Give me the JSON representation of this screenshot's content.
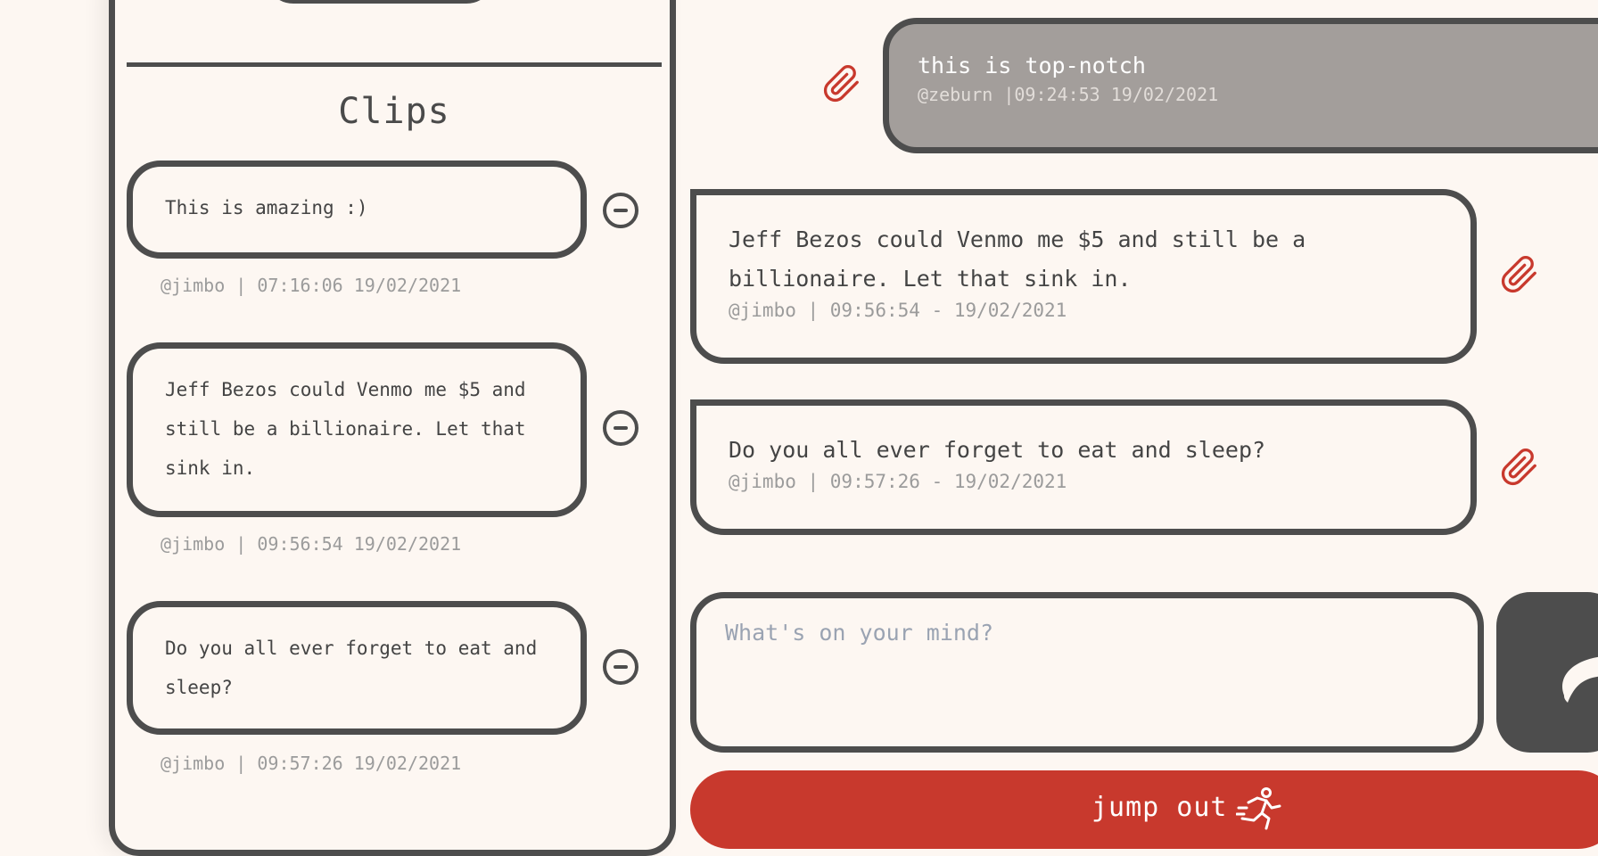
{
  "clips_panel": {
    "title": "Clips",
    "clips": [
      {
        "text": "This is amazing :)",
        "meta": "@jimbo | 07:16:06 19/02/2021"
      },
      {
        "text": "Jeff Bezos could Venmo me $5 and still be a billionaire. Let that sink in.",
        "meta": "@jimbo | 09:56:54 19/02/2021"
      },
      {
        "text": "Do you all ever forget to eat and sleep?",
        "meta": "@jimbo | 09:57:26 19/02/2021"
      }
    ]
  },
  "chat": {
    "own_message": {
      "text": "this is top-notch",
      "meta": "@zeburn |09:24:53 19/02/2021"
    },
    "messages": [
      {
        "text": "Jeff Bezos could Venmo me $5 and still be a billionaire. Let that sink in.",
        "meta": "@jimbo | 09:56:54 - 19/02/2021"
      },
      {
        "text": "Do you all ever forget to eat and sleep?",
        "meta": "@jimbo | 09:57:26 - 19/02/2021"
      }
    ],
    "compose": {
      "placeholder": "What's on your mind?"
    },
    "jump_out_label": "jump out"
  },
  "icons": {
    "remove_clip": "minus-circle-icon",
    "clip": "paperclip-icon",
    "send": "send-icon",
    "jump_out": "running-person-icon"
  },
  "colors": {
    "background": "#fdf7f2",
    "border": "#4d4d4d",
    "accent_red": "#c8392d",
    "own_bubble": "#a39e9b",
    "meta_text": "#9b9b9b"
  }
}
